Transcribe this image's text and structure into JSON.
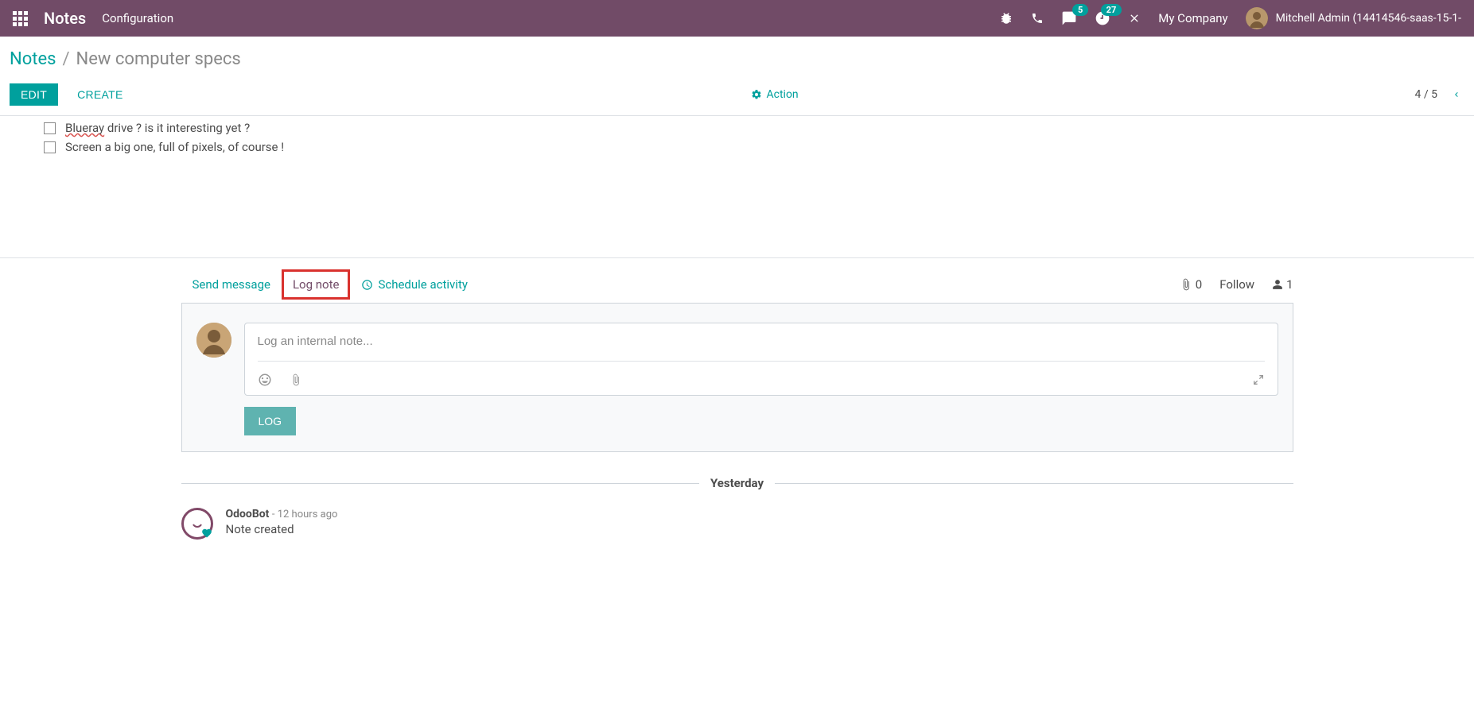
{
  "navbar": {
    "brand": "Notes",
    "menu_configuration": "Configuration",
    "messages_badge": "5",
    "activities_badge": "27",
    "company": "My Company",
    "user_name": "Mitchell Admin (14414546-saas-15-1-"
  },
  "breadcrumb": {
    "root": "Notes",
    "separator": "/",
    "current": "New computer specs"
  },
  "control": {
    "edit": "EDIT",
    "create": "CREATE",
    "action": "Action",
    "pager": "4 / 5"
  },
  "content": {
    "row1_word": "Blueray",
    "row1_rest": " drive ? is it interesting yet ?",
    "row2": "Screen a big one, full of pixels, of course !"
  },
  "chatter": {
    "send_message": "Send message",
    "log_note": "Log note",
    "schedule_activity": "Schedule activity",
    "attachments_count": "0",
    "follow": "Follow",
    "followers_count": "1",
    "input_placeholder": "Log an internal note...",
    "log_button": "LOG",
    "divider": "Yesterday"
  },
  "log": {
    "author": "OdooBot",
    "time": "- 12 hours ago",
    "text": "Note created"
  }
}
